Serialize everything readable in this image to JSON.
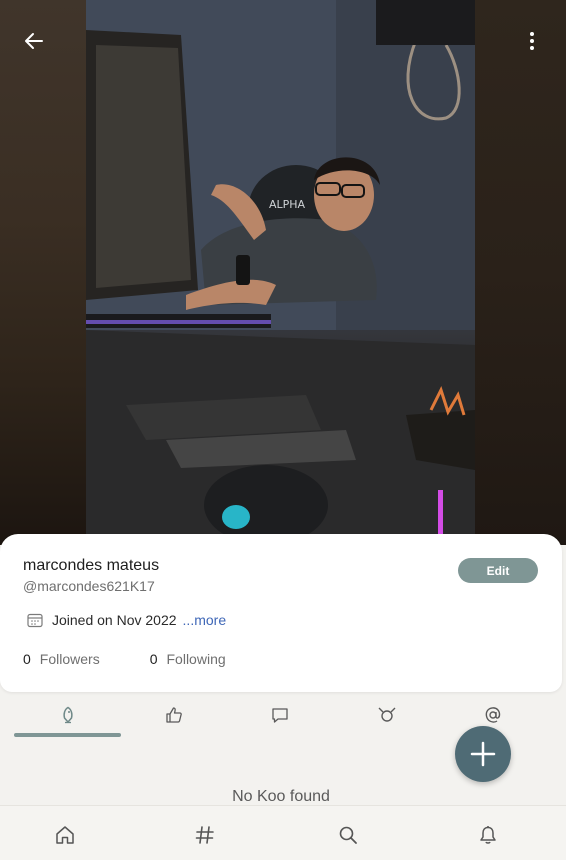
{
  "profile": {
    "name": "marcondes mateus",
    "handle": "@marcondes621K17",
    "edit_label": "Edit",
    "joined_text": "Joined on Nov 2022",
    "more_label": "...more",
    "followers_count": "0",
    "followers_label": "Followers",
    "following_count": "0",
    "following_label": "Following"
  },
  "header": {
    "back_icon": "arrow-left-icon",
    "menu_icon": "more-vertical-icon"
  },
  "tabs": [
    {
      "icon": "koo-bird-icon",
      "active": true
    },
    {
      "icon": "thumbs-up-icon",
      "active": false
    },
    {
      "icon": "comment-icon",
      "active": false
    },
    {
      "icon": "rekoo-icon",
      "active": false
    },
    {
      "icon": "at-mention-icon",
      "active": false
    }
  ],
  "empty_state": {
    "message": "No Koo found"
  },
  "bottom_nav": [
    {
      "icon": "home-icon"
    },
    {
      "icon": "hashtag-icon"
    },
    {
      "icon": "search-icon"
    },
    {
      "icon": "bell-icon"
    }
  ],
  "colors": {
    "accent": "#7f9695",
    "fab": "#4f6b75",
    "link": "#3f67b7",
    "background": "#f3f2ef"
  }
}
